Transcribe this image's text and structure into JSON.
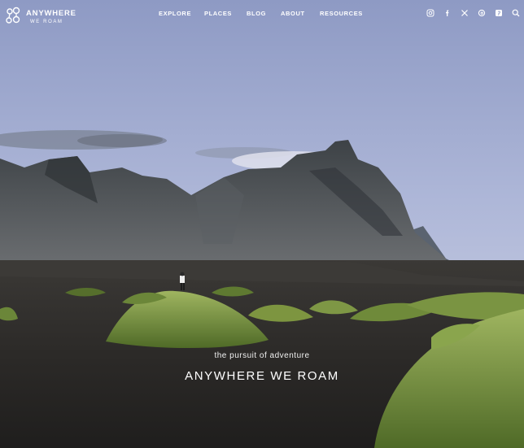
{
  "brand": {
    "name": "ANYWHERE",
    "sub": "WE ROAM"
  },
  "nav": {
    "items": [
      "EXPLORE",
      "PLACES",
      "BLOG",
      "ABOUT",
      "RESOURCES"
    ]
  },
  "social": {
    "icons": [
      "instagram-icon",
      "facebook-icon",
      "x-icon",
      "threads-icon",
      "pinterest-icon",
      "search-icon"
    ]
  },
  "hero": {
    "tagline": "the pursuit of adventure",
    "headline": "ANYWHERE WE ROAM"
  },
  "colors": {
    "sky_top": "#8f9bc6",
    "sky_bottom": "#ccd3e8",
    "mountain": "#4c5156",
    "sand": "#2a2827",
    "grass": "#6f8a3a",
    "text": "#ffffff"
  }
}
